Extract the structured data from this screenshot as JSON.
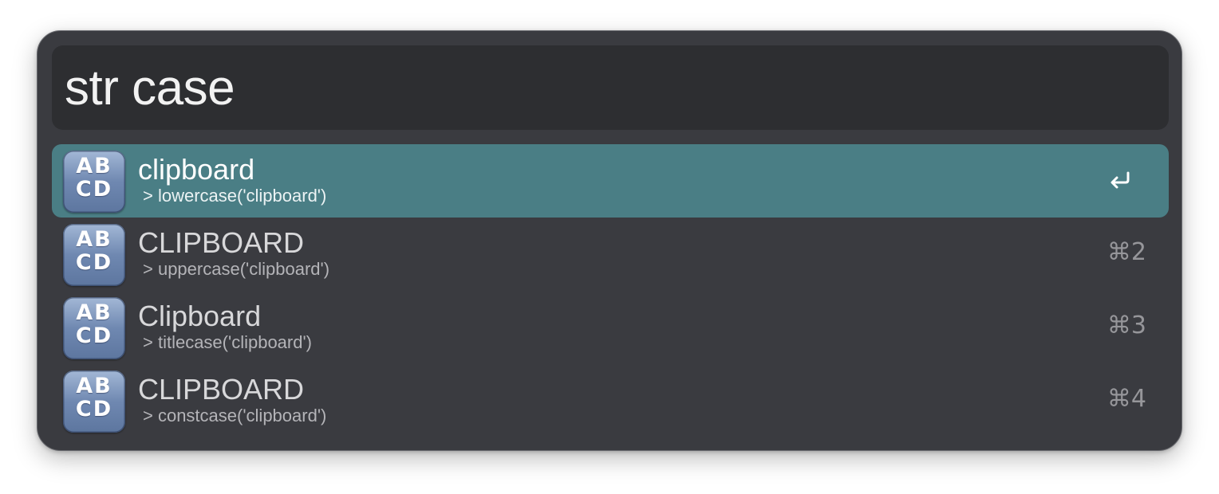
{
  "search": {
    "query": "str case"
  },
  "icon": {
    "top_letters": "AB",
    "bottom_letters": "CD",
    "name": "abcd-icon"
  },
  "colors": {
    "selected_row": "#4a7e85",
    "window_bg": "#3a3b40",
    "search_bg": "#2d2e31"
  },
  "results": [
    {
      "title": "clipboard",
      "subtitle": "> lowercase('clipboard')",
      "shortcut": "",
      "selected": true,
      "action_icon": "return-icon"
    },
    {
      "title": "CLIPBOARD",
      "subtitle": "> uppercase('clipboard')",
      "shortcut": "⌘2",
      "selected": false
    },
    {
      "title": "Clipboard",
      "subtitle": "> titlecase('clipboard')",
      "shortcut": "⌘3",
      "selected": false
    },
    {
      "title": "CLIPBOARD",
      "subtitle": "> constcase('clipboard')",
      "shortcut": "⌘4",
      "selected": false
    }
  ]
}
